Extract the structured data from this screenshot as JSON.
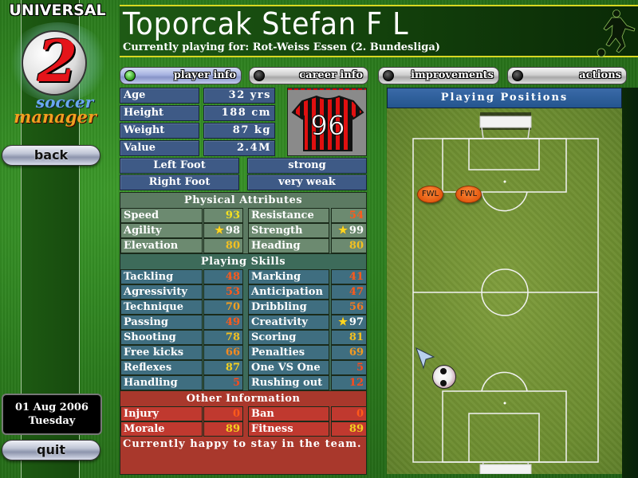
{
  "logo": {
    "title": "UNIVERSAL",
    "number": "2",
    "line1": "soccer",
    "line2": "manager"
  },
  "header": {
    "player_name": "Toporcak Stefan F L",
    "club_line": "Currently playing for: Rot-Weiss Essen (2. Bundesliga)"
  },
  "nav": {
    "back": "back",
    "quit": "quit",
    "date": "01 Aug 2006",
    "weekday": "Tuesday"
  },
  "tabs": [
    {
      "label": "player info",
      "active": true
    },
    {
      "label": "career info",
      "active": false
    },
    {
      "label": "improvements",
      "active": false
    },
    {
      "label": "actions",
      "active": false
    }
  ],
  "bio": [
    {
      "label": "Age",
      "value": "32 yrs"
    },
    {
      "label": "Height",
      "value": "188 cm"
    },
    {
      "label": "Weight",
      "value": "87 kg"
    },
    {
      "label": "Value",
      "value": "2.4M"
    }
  ],
  "shirt": {
    "number": "96",
    "colors": {
      "stripe_a": "#e01010",
      "stripe_b": "#111111",
      "number": "#ffffff"
    }
  },
  "feet": [
    {
      "label": "Left Foot",
      "value": "strong"
    },
    {
      "label": "Right Foot",
      "value": "very weak"
    }
  ],
  "physical": {
    "title": "Physical Attributes",
    "rows": [
      [
        {
          "label": "Speed",
          "value": "93",
          "star": false,
          "color": "#f4e020"
        },
        {
          "label": "Resistance",
          "value": "54",
          "star": false,
          "color": "#ff5a1a"
        }
      ],
      [
        {
          "label": "Agility",
          "value": "98",
          "star": true,
          "color": "#ffffff"
        },
        {
          "label": "Strength",
          "value": "99",
          "star": true,
          "color": "#ffffff"
        }
      ],
      [
        {
          "label": "Elevation",
          "value": "80",
          "star": false,
          "color": "#f4c020"
        },
        {
          "label": "Heading",
          "value": "80",
          "star": false,
          "color": "#f4c020"
        }
      ]
    ]
  },
  "skills": {
    "title": "Playing Skills",
    "rows": [
      [
        {
          "label": "Tackling",
          "value": "48",
          "star": false,
          "color": "#ff5a1a"
        },
        {
          "label": "Marking",
          "value": "41",
          "star": false,
          "color": "#ff5a1a"
        }
      ],
      [
        {
          "label": "Agressivity",
          "value": "53",
          "star": false,
          "color": "#ff5a1a"
        },
        {
          "label": "Anticipation",
          "value": "47",
          "star": false,
          "color": "#ff5a1a"
        }
      ],
      [
        {
          "label": "Technique",
          "value": "70",
          "star": false,
          "color": "#f4a020"
        },
        {
          "label": "Dribbling",
          "value": "56",
          "star": false,
          "color": "#f47a20"
        }
      ],
      [
        {
          "label": "Passing",
          "value": "49",
          "star": false,
          "color": "#ff5a1a"
        },
        {
          "label": "Creativity",
          "value": "97",
          "star": true,
          "color": "#ffffff"
        }
      ],
      [
        {
          "label": "Shooting",
          "value": "78",
          "star": false,
          "color": "#f4c020"
        },
        {
          "label": "Scoring",
          "value": "81",
          "star": false,
          "color": "#f4c020"
        }
      ],
      [
        {
          "label": "Free kicks",
          "value": "66",
          "star": false,
          "color": "#f48a20"
        },
        {
          "label": "Penalties",
          "value": "69",
          "star": false,
          "color": "#f49a20"
        }
      ],
      [
        {
          "label": "Reflexes",
          "value": "87",
          "star": false,
          "color": "#f4d020"
        },
        {
          "label": "One VS One",
          "value": "5",
          "star": false,
          "color": "#ff4a1a"
        }
      ],
      [
        {
          "label": "Handling",
          "value": "5",
          "star": false,
          "color": "#ff4a1a"
        },
        {
          "label": "Rushing out",
          "value": "12",
          "star": false,
          "color": "#ff4a1a"
        }
      ]
    ]
  },
  "other": {
    "title": "Other Information",
    "rows": [
      [
        {
          "label": "Injury",
          "value": "0",
          "star": false,
          "color": "#ff5a1a"
        },
        {
          "label": "Ban",
          "value": "0",
          "star": false,
          "color": "#ff5a1a"
        }
      ],
      [
        {
          "label": "Morale",
          "value": "89",
          "star": false,
          "color": "#f4d020"
        },
        {
          "label": "Fitness",
          "value": "89",
          "star": false,
          "color": "#f4d020"
        }
      ]
    ],
    "mood": "Currently happy to stay in the team."
  },
  "positions": {
    "title": "Playing Positions",
    "badges": [
      "FWL",
      "FWL"
    ]
  }
}
